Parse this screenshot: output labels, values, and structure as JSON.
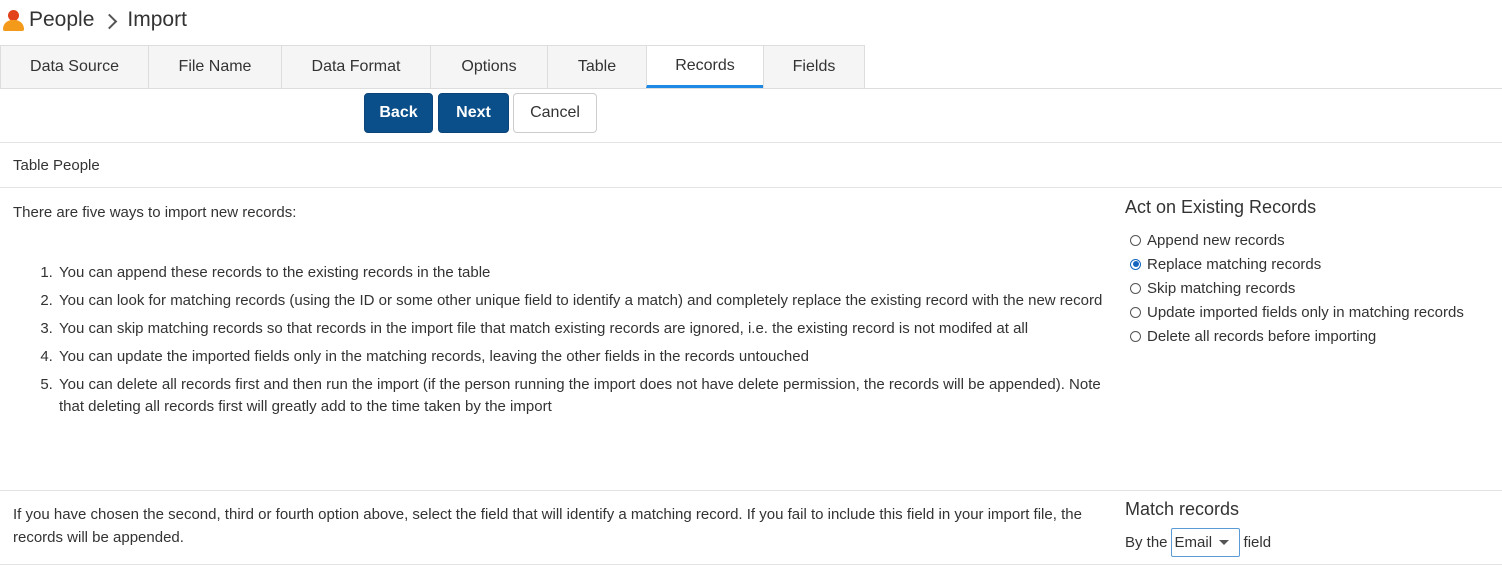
{
  "breadcrumb": {
    "root": "People",
    "current": "Import",
    "icon": "person-icon"
  },
  "tabs": [
    {
      "label": "Data Source",
      "active": false
    },
    {
      "label": "File Name",
      "active": false
    },
    {
      "label": "Data Format",
      "active": false
    },
    {
      "label": "Options",
      "active": false
    },
    {
      "label": "Table",
      "active": false
    },
    {
      "label": "Records",
      "active": true
    },
    {
      "label": "Fields",
      "active": false
    }
  ],
  "buttons": {
    "back": "Back",
    "next": "Next",
    "cancel": "Cancel"
  },
  "table_title": "Table People",
  "intro": "There are five ways to import new records:",
  "ways": [
    "You can append these records to the existing records in the table",
    "You can look for matching records (using the ID or some other unique field to identify a match) and completely replace the existing record with the new record",
    "You can skip matching records so that records in the import file that match existing records are ignored, i.e. the existing record is not modifed at all",
    "You can update the imported fields only in the matching records, leaving the other fields in the records untouched",
    "You can delete all records first and then run the import (if the person running the import does not have delete permission, the records will be appended). Note that deleting all records first will greatly add to the time taken by the import"
  ],
  "act_on_existing": {
    "title": "Act on Existing Records",
    "options": [
      {
        "label": "Append new records",
        "checked": false
      },
      {
        "label": "Replace matching records",
        "checked": true
      },
      {
        "label": "Skip matching records",
        "checked": false
      },
      {
        "label": "Update imported fields only in matching records",
        "checked": false
      },
      {
        "label": "Delete all records before importing",
        "checked": false
      }
    ]
  },
  "match": {
    "text": "If you have chosen the second, third or fourth option above, select the field that will identify a matching record. If you fail to include this field in your import file, the records will be appended.",
    "title": "Match records",
    "prefix": "By the",
    "selected": "Email",
    "suffix": "field"
  },
  "colors": {
    "primary_button": "#0b4f8a",
    "active_tab_underline": "#1e88e5",
    "radio_checked": "#1565c0"
  }
}
